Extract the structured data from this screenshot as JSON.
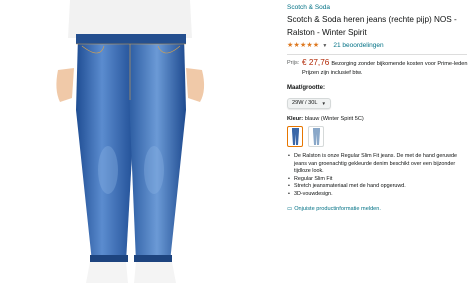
{
  "product": {
    "brand": "Scotch & Soda",
    "title": "Scotch & Soda heren jeans (rechte pijp) NOS - Ralston - Winter Spirit",
    "rating_stars": "★★★★★",
    "reviews": "21 beoordelingen"
  },
  "price": {
    "label": "Prijs:",
    "amount": "€ 27,76",
    "delivery": "Bezorging zonder bijkomende kosten voor Prime-leden",
    "vat": "Prijzen zijn inclusief btw."
  },
  "size": {
    "label": "Maat/grootte:",
    "selected": "29W / 30L"
  },
  "color": {
    "label": "Kleur:",
    "value": "blauw (Winter Spirit 5C)",
    "swatch_colors": [
      "#3a67a8",
      "#8aa8c9"
    ]
  },
  "bullets": [
    "De Ralston is onze Regular Slim Fit jeans. De met de hand geruwde jeans van groenachtig gekleurde denim beschikt over een bijzonder tijdloze look.",
    "Regular Slim Fit",
    "Stretch jeansmateriaal met de hand opgeruwd.",
    "3D-vouwdesign."
  ],
  "report": {
    "icon": "chat-icon",
    "label": "Onjuiste productinformatie melden."
  },
  "colors": {
    "link": "#007185",
    "price": "#b12704",
    "star": "#de7921",
    "denim": "#2f5fa6"
  }
}
